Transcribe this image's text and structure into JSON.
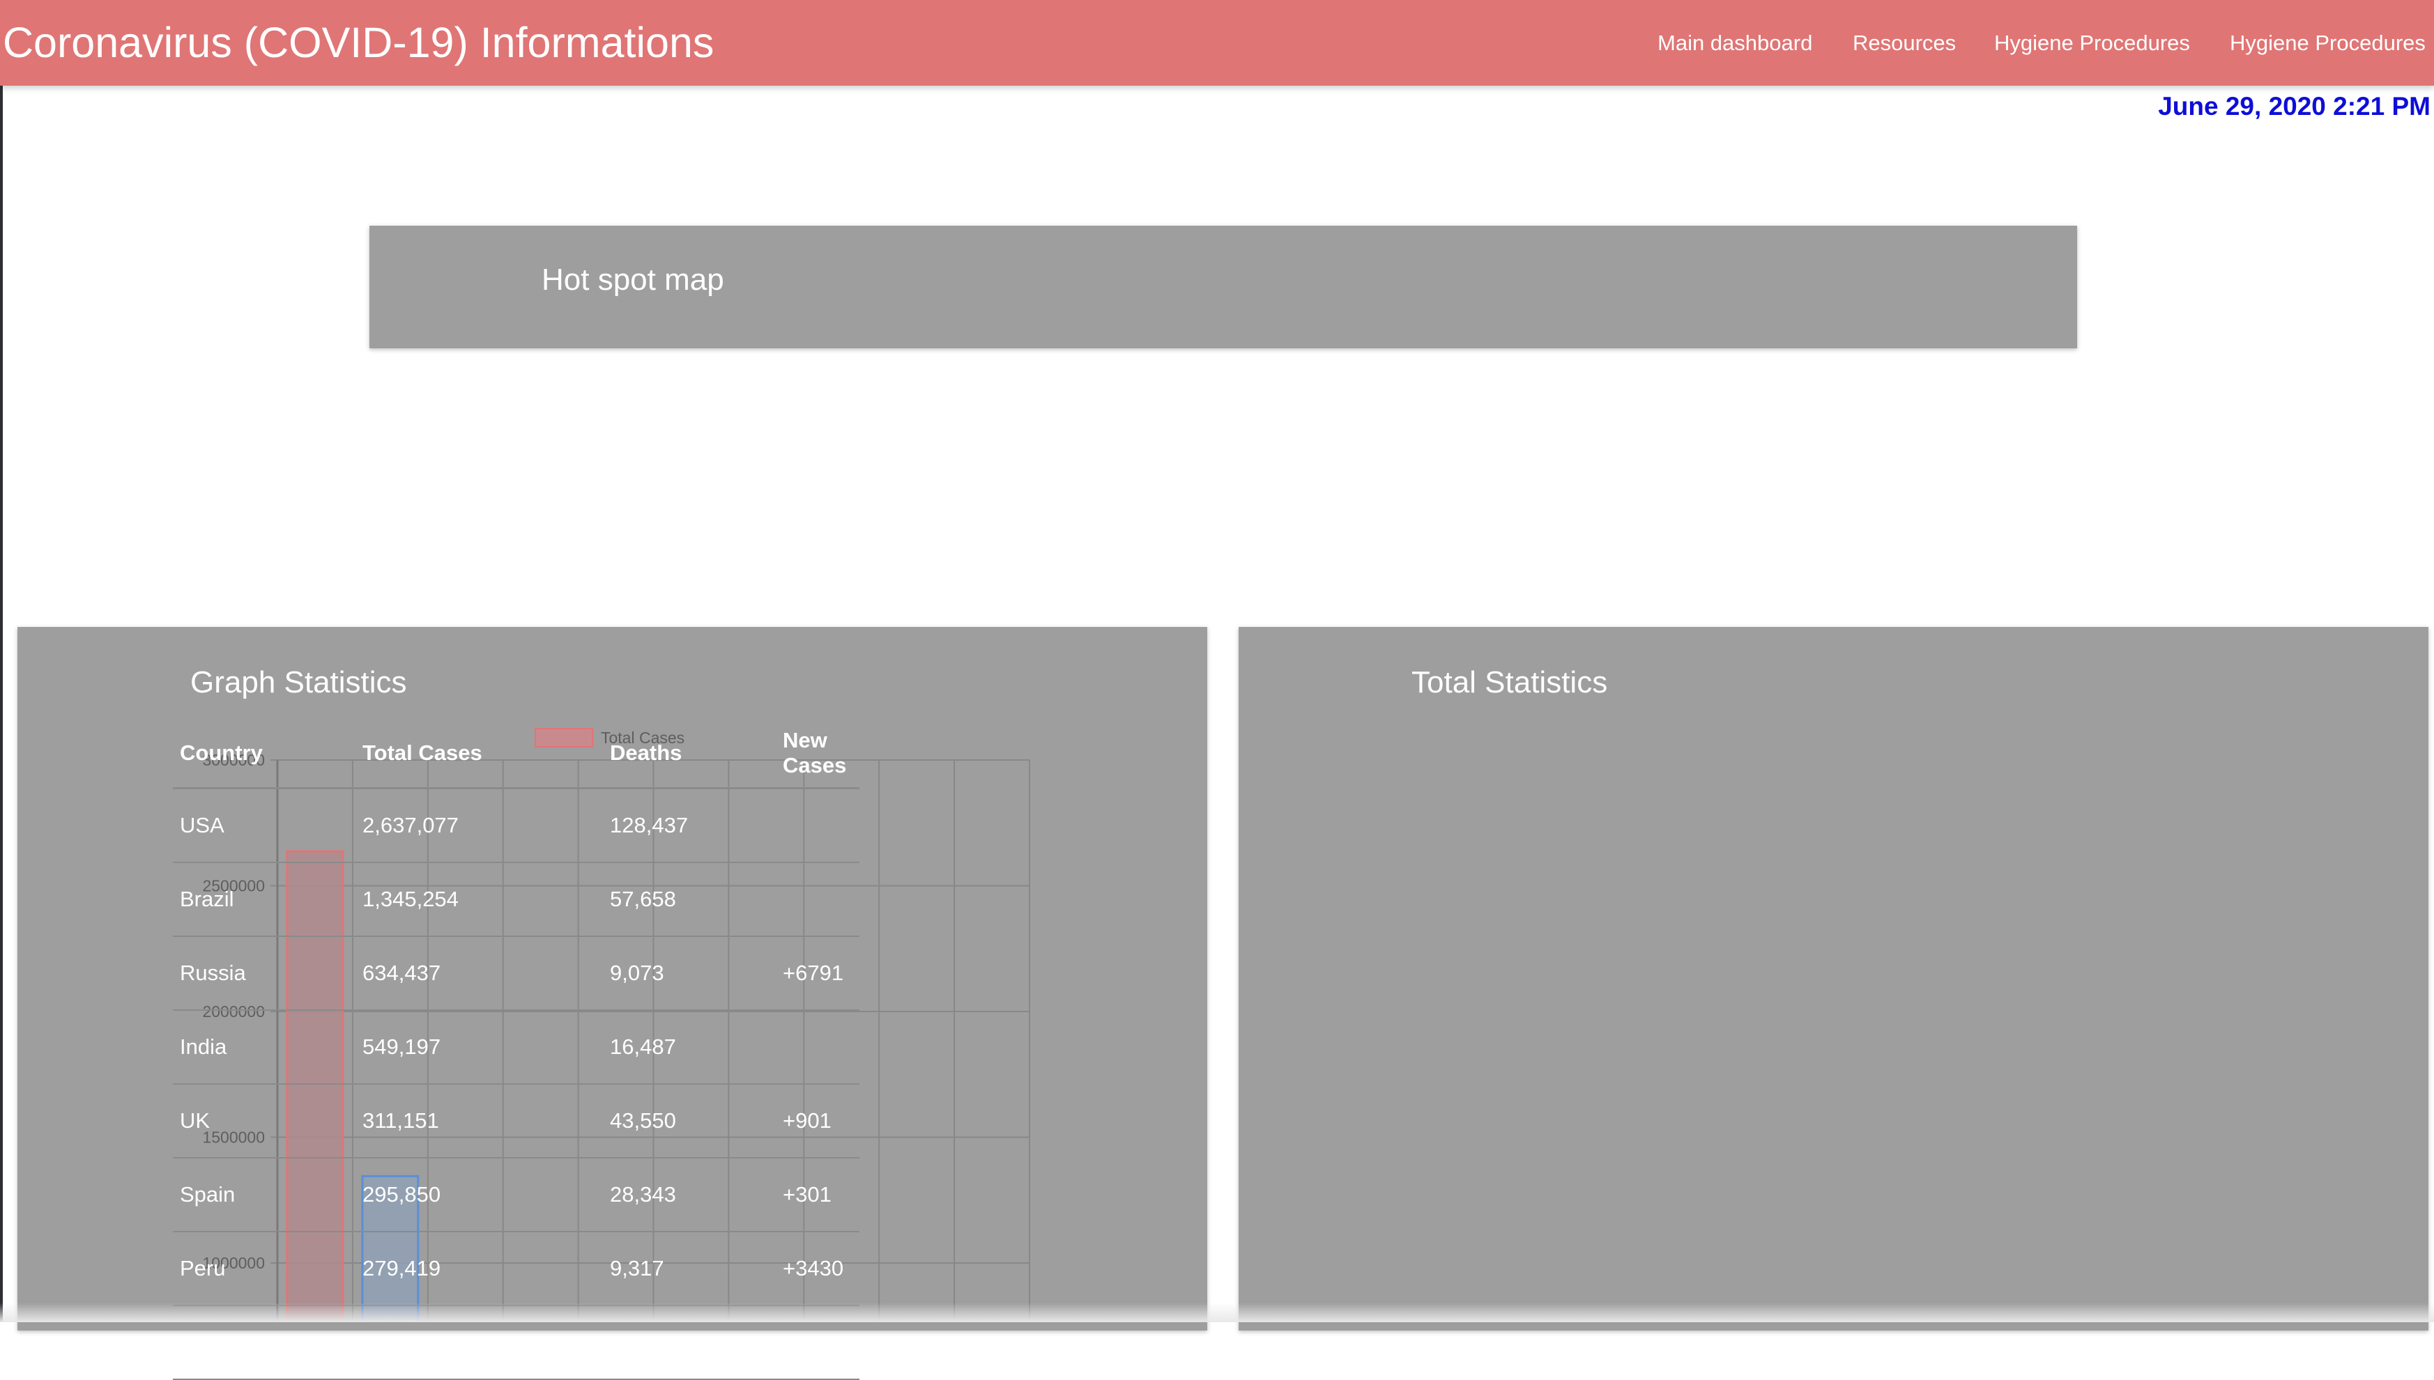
{
  "header": {
    "title": "Coronavirus (COVID-19) Informations",
    "nav": [
      "Main dashboard",
      "Resources",
      "Hygiene Procedures",
      "Hygiene Procedures"
    ]
  },
  "datetime": "June 29, 2020 2:21 PM",
  "map_card": {
    "title": "Hot spot map"
  },
  "graph_card": {
    "title": "Graph Statistics"
  },
  "stats_card": {
    "title": "Total Statistics",
    "columns": [
      "Country",
      "Total Cases",
      "Deaths",
      "New Cases"
    ],
    "rows": [
      [
        "USA",
        "2,637,077",
        "128,437",
        ""
      ],
      [
        "Brazil",
        "1,345,254",
        "57,658",
        ""
      ],
      [
        "Russia",
        "634,437",
        "9,073",
        "+6791"
      ],
      [
        "India",
        "549,197",
        "16,487",
        ""
      ],
      [
        "UK",
        "311,151",
        "43,550",
        "+901"
      ],
      [
        "Spain",
        "295,850",
        "28,343",
        "+301"
      ],
      [
        "Peru",
        "279,419",
        "9,317",
        "+3430"
      ]
    ]
  },
  "chart_data": {
    "type": "bar",
    "title": "",
    "legend": "Total Cases",
    "categories": [],
    "series": [
      {
        "name": "Total Cases",
        "values": [
          2637077,
          1345254
        ]
      }
    ],
    "bar_colors": [
      "#e07575",
      "#5b8fd6"
    ],
    "y_ticks": [
      "3000000",
      "2500000",
      "2000000",
      "1500000",
      "1000000"
    ],
    "ylim": [
      1000000,
      3000000
    ],
    "grid": true
  }
}
